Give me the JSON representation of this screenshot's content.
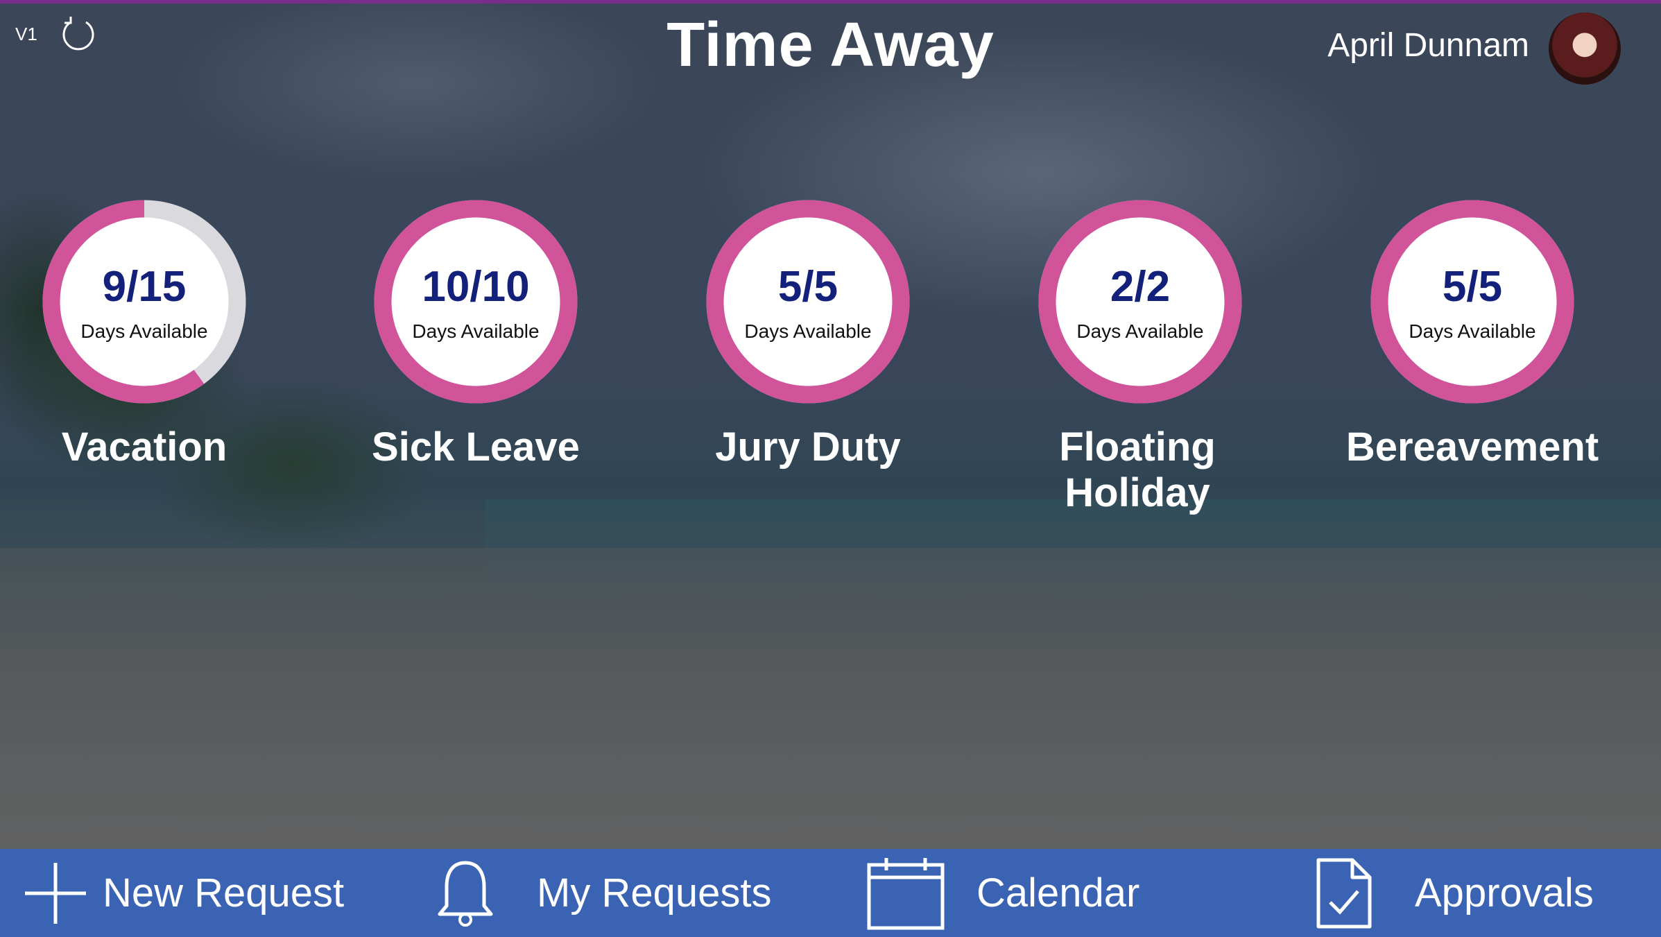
{
  "app": {
    "version": "V1",
    "title": "Time Away"
  },
  "user": {
    "name": "April Dunnam"
  },
  "balances": [
    {
      "category": "Vacation",
      "available": 9,
      "total": 15,
      "display": "9/15",
      "sub_label": "Days Available"
    },
    {
      "category": "Sick Leave",
      "available": 10,
      "total": 10,
      "display": "10/10",
      "sub_label": "Days Available"
    },
    {
      "category": "Jury Duty",
      "available": 5,
      "total": 5,
      "display": "5/5",
      "sub_label": "Days Available"
    },
    {
      "category": "Floating Holiday",
      "available": 2,
      "total": 2,
      "display": "2/2",
      "sub_label": "Days Available"
    },
    {
      "category": "Bereavement",
      "available": 5,
      "total": 5,
      "display": "5/5",
      "sub_label": "Days Available"
    }
  ],
  "nav": {
    "new_request": {
      "label": "New Request",
      "icon": "plus-icon"
    },
    "my_requests": {
      "label": "My Requests",
      "icon": "bell-icon"
    },
    "calendar": {
      "label": "Calendar",
      "icon": "calendar-icon"
    },
    "approvals": {
      "label": "Approvals",
      "icon": "document-check-icon"
    }
  },
  "colors": {
    "gauge_fill": "#d1539a",
    "gauge_track": "#d9d9de",
    "gauge_number": "#14217a",
    "nav_background": "#3b63b4",
    "top_accent": "#7a2d8a"
  }
}
